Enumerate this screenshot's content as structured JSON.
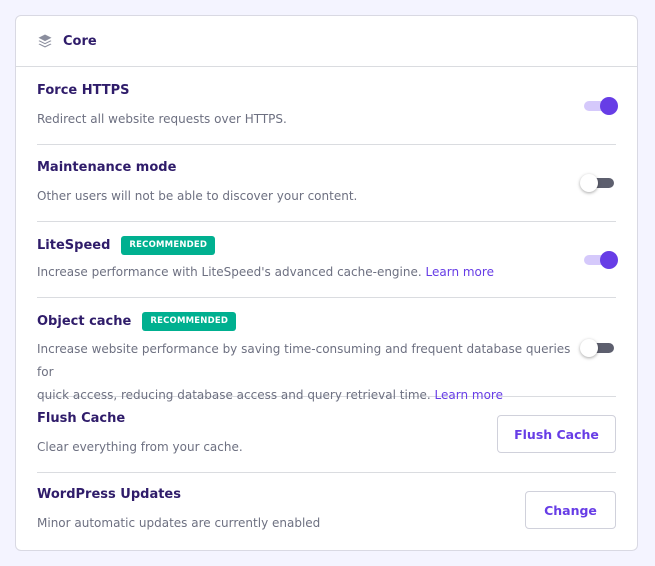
{
  "header": {
    "title": "Core",
    "icon": "layers-icon"
  },
  "colors": {
    "accent": "#673de6",
    "badge": "#00b090",
    "text": "#2f1c6a",
    "muted": "#6d7081"
  },
  "rows": {
    "force_https": {
      "title": "Force HTTPS",
      "description": "Redirect all website requests over HTTPS.",
      "enabled": true
    },
    "maintenance": {
      "title": "Maintenance mode",
      "description": "Other users will not be able to discover your content.",
      "enabled": false
    },
    "litespeed": {
      "title": "LiteSpeed",
      "badge": "RECOMMENDED",
      "description": "Increase performance with LiteSpeed's advanced cache-engine.",
      "link": "Learn more",
      "enabled": true
    },
    "object_cache": {
      "title": "Object cache",
      "badge": "RECOMMENDED",
      "description_line1": "Increase website performance by saving time-consuming and frequent database queries for",
      "description_line2": "quick access, reducing database access and query retrieval time.",
      "link": "Learn more",
      "enabled": false
    },
    "flush_cache": {
      "title": "Flush Cache",
      "description": "Clear everything from your cache.",
      "button": "Flush Cache"
    },
    "wp_updates": {
      "title": "WordPress Updates",
      "description": "Minor automatic updates are currently enabled",
      "button": "Change"
    }
  }
}
